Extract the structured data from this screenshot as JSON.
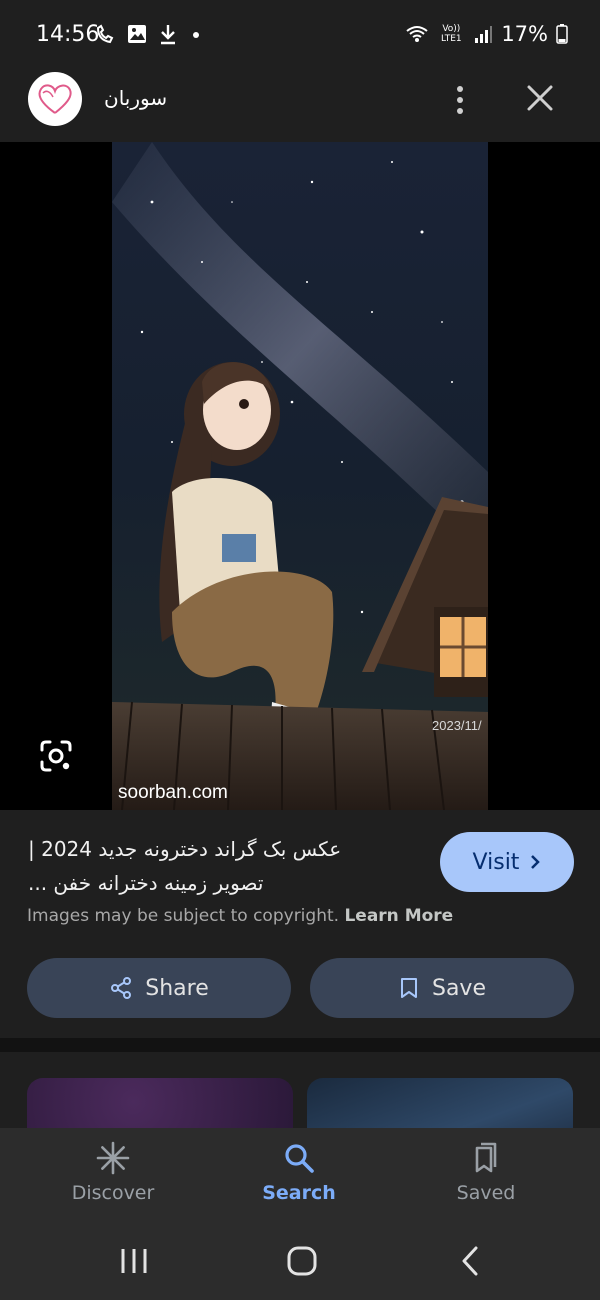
{
  "status_bar": {
    "time": "14:56",
    "battery": "17%",
    "network": "Vo)) LTE1"
  },
  "header": {
    "site_name": "سوربان",
    "logo_icon": "heart-icon"
  },
  "image": {
    "watermark": "soorban.com",
    "date_stamp": "2023/11/"
  },
  "result": {
    "title_line1": "عکس بک گراند دخترونه جدید 2024 |",
    "title_line2": "تصویر زمینه دخترانه خفن ...",
    "visit_label": "Visit",
    "copyright_text": "Images may be subject to copyright.",
    "learn_more": "Learn More",
    "share_label": "Share",
    "save_label": "Save"
  },
  "bottom_nav": {
    "items": [
      {
        "label": "Discover",
        "icon": "asterisk-icon",
        "active": false
      },
      {
        "label": "Search",
        "icon": "search-icon",
        "active": true
      },
      {
        "label": "Saved",
        "icon": "bookmarks-icon",
        "active": false
      }
    ]
  },
  "colors": {
    "accent": "#a8c7fa",
    "active_nav": "#7cacf8",
    "background": "#1f1f1f",
    "button_bg": "#394457"
  }
}
